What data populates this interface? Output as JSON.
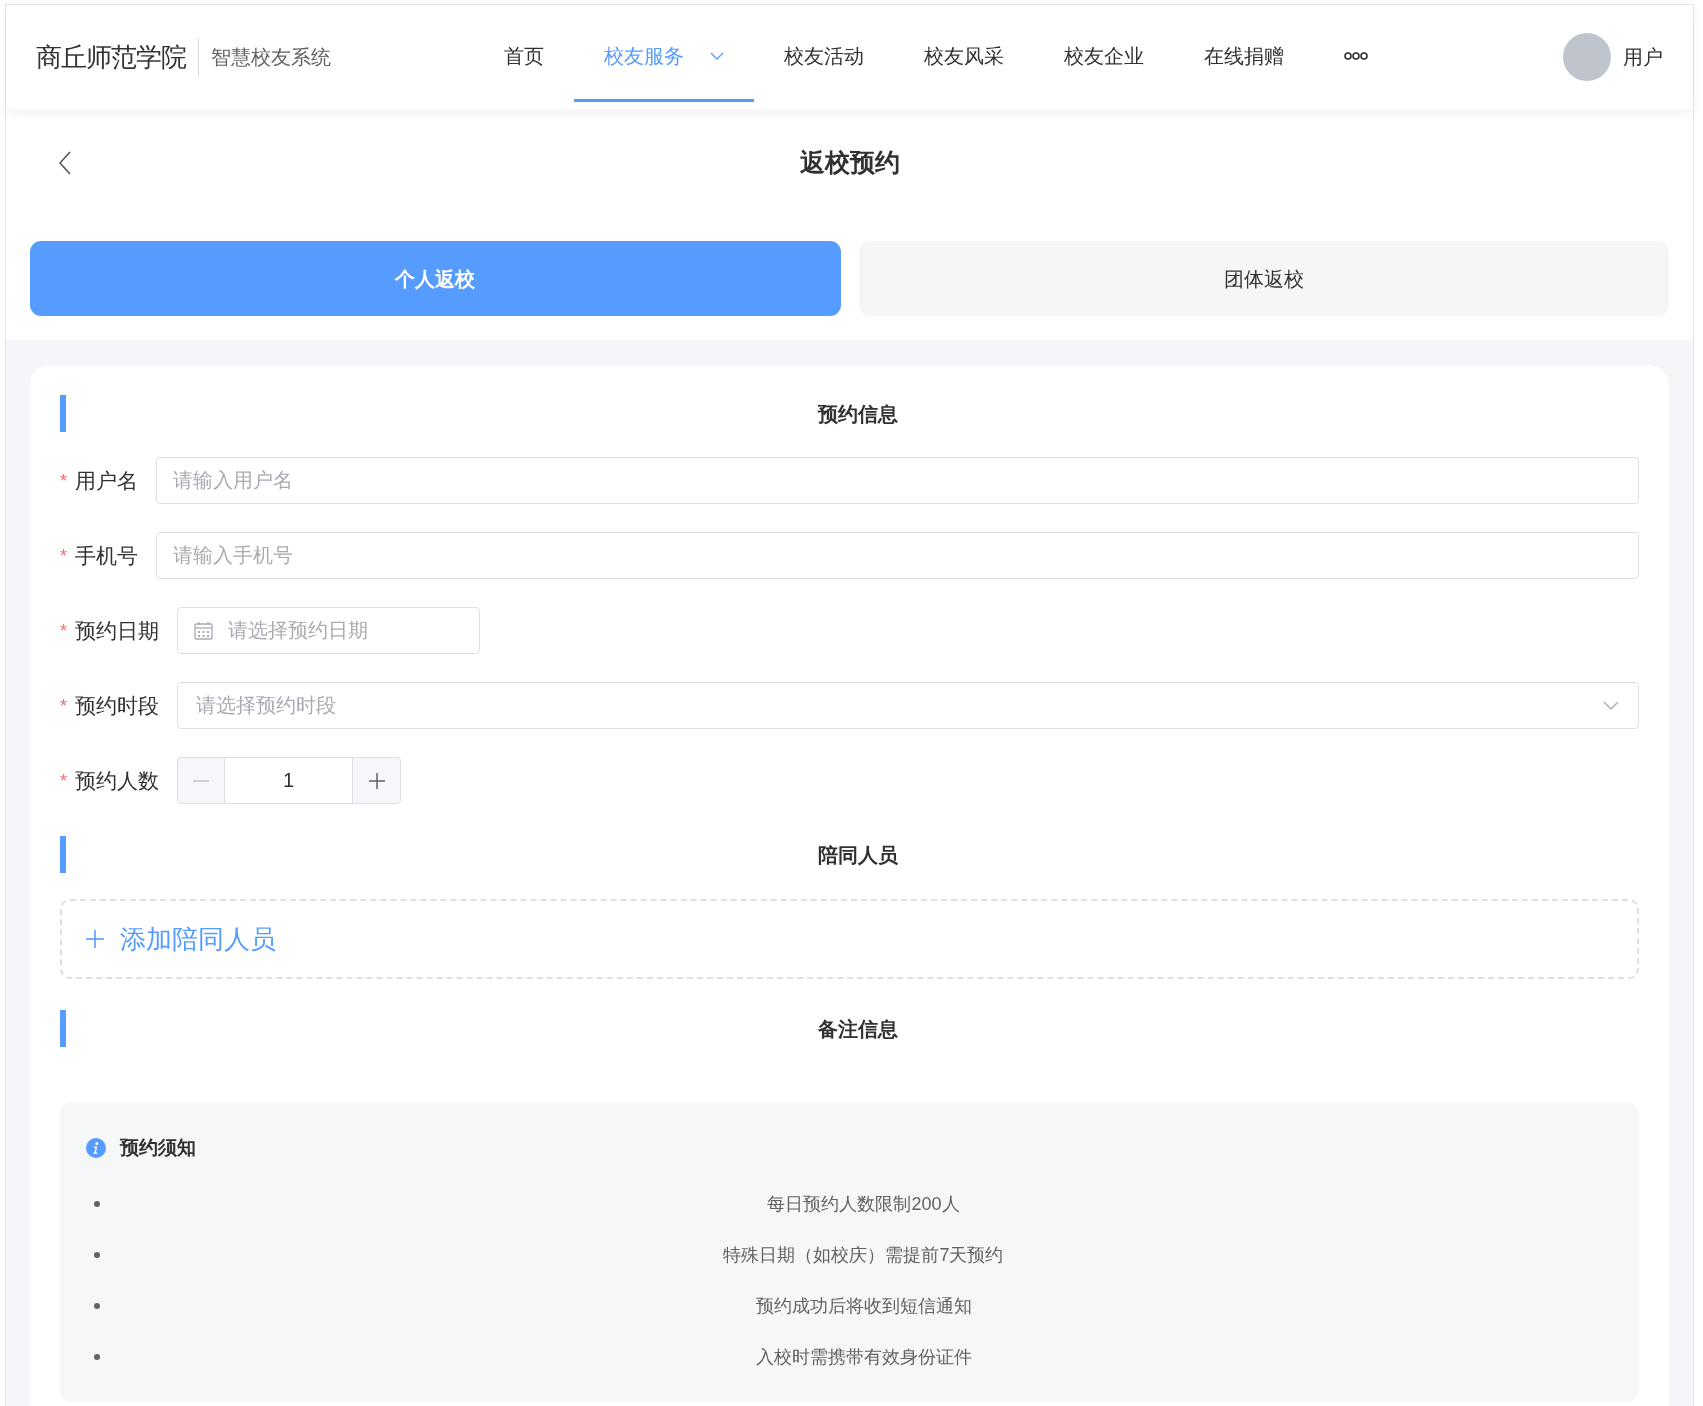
{
  "header": {
    "logo": "商丘师范学院",
    "system_name": "智慧校友系统",
    "nav": [
      {
        "label": "首页",
        "selected": false,
        "dropdown": false
      },
      {
        "label": "校友服务",
        "selected": true,
        "dropdown": true
      },
      {
        "label": "校友活动",
        "selected": false,
        "dropdown": false
      },
      {
        "label": "校友风采",
        "selected": false,
        "dropdown": false
      },
      {
        "label": "校友企业",
        "selected": false,
        "dropdown": false
      },
      {
        "label": "在线捐赠",
        "selected": false,
        "dropdown": false
      }
    ],
    "user": {
      "name": "用户"
    }
  },
  "page": {
    "title": "返校预约"
  },
  "tabs": [
    {
      "label": "个人返校",
      "selected": true
    },
    {
      "label": "团体返校",
      "selected": false
    }
  ],
  "booking": {
    "title": "预约信息",
    "fields": [
      {
        "kind": "text",
        "required_mark": "*",
        "label": "用户名",
        "placeholder": "请输入用户名"
      },
      {
        "kind": "text",
        "required_mark": "*",
        "label": "手机号",
        "placeholder": "请输入手机号"
      },
      {
        "kind": "date",
        "required_mark": "*",
        "label": "预约日期",
        "placeholder": "请选择预约日期"
      },
      {
        "kind": "select",
        "required_mark": "*",
        "label": "预约时段",
        "placeholder": "请选择预约时段"
      },
      {
        "kind": "number",
        "required_mark": "*",
        "label": "预约人数",
        "value": "1",
        "decrease_disabled": true
      }
    ]
  },
  "companions": {
    "title": "陪同人员",
    "add_button": "添加陪同人员"
  },
  "remarks": {
    "title": "备注信息"
  },
  "notice": {
    "title": "预约须知",
    "items": [
      "每日预约人数限制200人",
      "特殊日期（如校庆）需提前7天预约",
      "预约成功后将收到短信通知",
      "入校时需携带有效身份证件"
    ]
  }
}
